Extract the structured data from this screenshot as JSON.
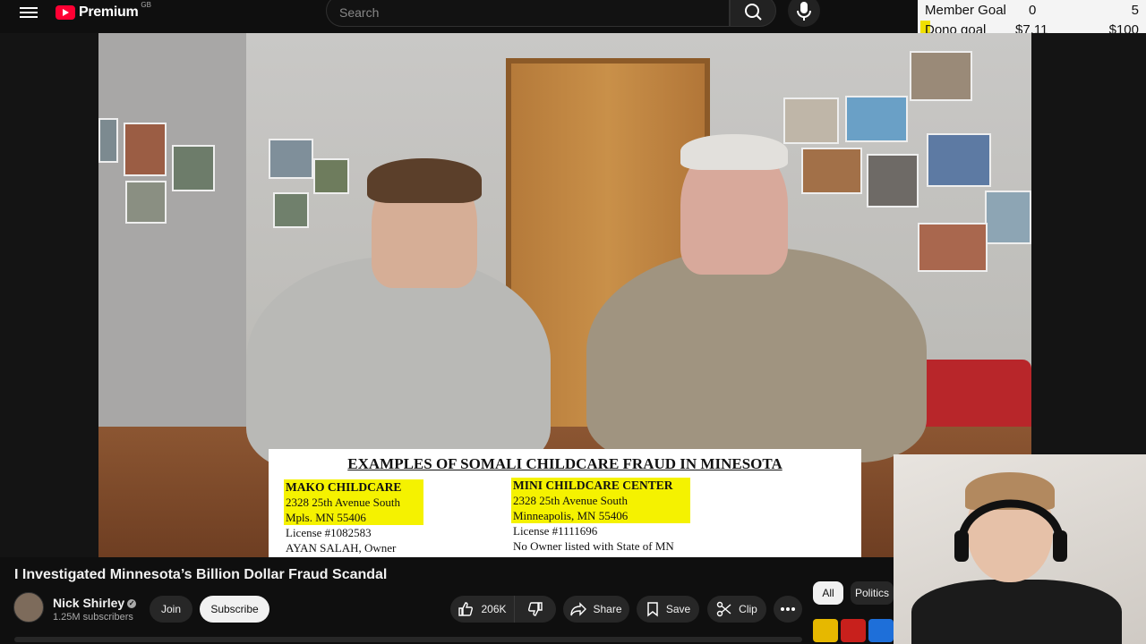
{
  "header": {
    "logo_text": "Premium",
    "region": "GB",
    "search_placeholder": "Search",
    "icons": [
      "menu-icon",
      "youtube-logo-icon",
      "search-icon",
      "mic-icon"
    ]
  },
  "goals": [
    {
      "label": "Member Goal",
      "current": "0",
      "target": "5"
    },
    {
      "label": "Dono goal",
      "current": "$7.11",
      "target": "$100"
    }
  ],
  "video_overlay": {
    "title": "EXAMPLES OF SOMALI CHILDCARE FRAUD IN MINESOTA",
    "left": {
      "name": "MAKO CHILDCARE",
      "address1": "2328 25th Avenue South",
      "address2": "Mpls. MN  55406",
      "license": "License #1082583",
      "owner": "AYAN SALAH, Owner"
    },
    "right": {
      "name": "MINI CHILDCARE CENTER",
      "address1": "2328 25th Avenue South",
      "address2": "Minneapolis, MN 55406",
      "license": "License #1111696",
      "owner": "No Owner listed with State of MN"
    }
  },
  "video": {
    "title": "I Investigated Minnesota’s Billion Dollar Fraud Scandal",
    "channel": "Nick Shirley",
    "subscribers": "1.25M subscribers",
    "join_label": "Join",
    "subscribe_label": "Subscribe",
    "likes": "206K",
    "share_label": "Share",
    "save_label": "Save",
    "clip_label": "Clip"
  },
  "chips": [
    "All",
    "Politics"
  ],
  "colors": {
    "background": "#0f0f0f",
    "button": "#272727",
    "brand_red": "#ff0033",
    "highlight": "#f5f200"
  }
}
